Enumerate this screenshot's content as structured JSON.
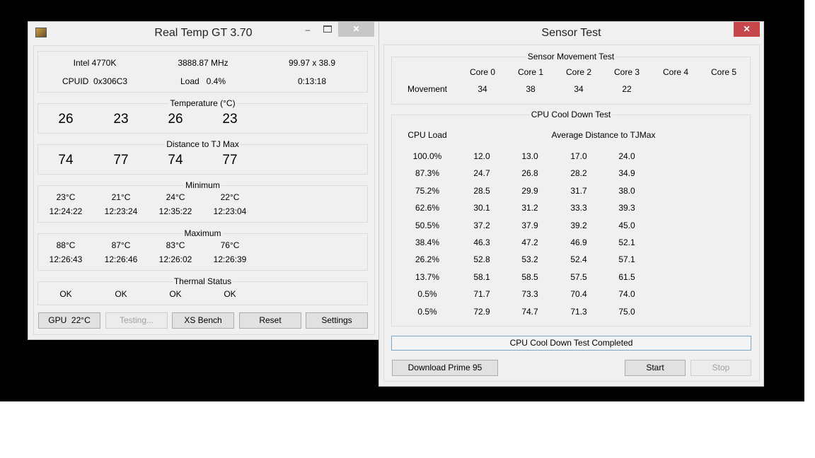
{
  "realtemp": {
    "title": "Real Temp GT 3.70",
    "cpu": "Intel 4770K",
    "mhz": "3888.87 MHz",
    "multiplier": "99.97 x 38.9",
    "cpuid": "CPUID  0x306C3",
    "load": "Load   0.4%",
    "uptime": "0:13:18",
    "temperature": {
      "label": "Temperature (°C)",
      "values": [
        "26",
        "23",
        "26",
        "23"
      ]
    },
    "distance": {
      "label": "Distance to TJ Max",
      "values": [
        "74",
        "77",
        "74",
        "77"
      ]
    },
    "minimum": {
      "label": "Minimum",
      "temps": [
        "23°C",
        "21°C",
        "24°C",
        "22°C"
      ],
      "times": [
        "12:24:22",
        "12:23:24",
        "12:35:22",
        "12:23:04"
      ]
    },
    "maximum": {
      "label": "Maximum",
      "temps": [
        "88°C",
        "87°C",
        "83°C",
        "76°C"
      ],
      "times": [
        "12:26:43",
        "12:26:46",
        "12:26:02",
        "12:26:39"
      ]
    },
    "thermal": {
      "label": "Thermal Status",
      "values": [
        "OK",
        "OK",
        "OK",
        "OK"
      ]
    },
    "buttons": {
      "gpu": "GPU  22°C",
      "testing": "Testing...",
      "xs_bench": "XS Bench",
      "reset": "Reset",
      "settings": "Settings"
    }
  },
  "sensortest": {
    "title": "Sensor Test",
    "movement": {
      "label": "Sensor Movement Test",
      "row_label": "Movement",
      "cores": [
        "Core 0",
        "Core 1",
        "Core 2",
        "Core 3",
        "Core 4",
        "Core 5"
      ],
      "values": [
        "34",
        "38",
        "34",
        "22"
      ]
    },
    "cooldown": {
      "label": "CPU Cool Down Test",
      "load_header": "CPU Load",
      "avg_header": "Average Distance to TJMax",
      "rows": [
        {
          "load": "100.0%",
          "values": [
            "12.0",
            "13.0",
            "17.0",
            "24.0"
          ]
        },
        {
          "load": "87.3%",
          "values": [
            "24.7",
            "26.8",
            "28.2",
            "34.9"
          ]
        },
        {
          "load": "75.2%",
          "values": [
            "28.5",
            "29.9",
            "31.7",
            "38.0"
          ]
        },
        {
          "load": "62.6%",
          "values": [
            "30.1",
            "31.2",
            "33.3",
            "39.3"
          ]
        },
        {
          "load": "50.5%",
          "values": [
            "37.2",
            "37.9",
            "39.2",
            "45.0"
          ]
        },
        {
          "load": "38.4%",
          "values": [
            "46.3",
            "47.2",
            "46.9",
            "52.1"
          ]
        },
        {
          "load": "26.2%",
          "values": [
            "52.8",
            "53.2",
            "52.4",
            "57.1"
          ]
        },
        {
          "load": "13.7%",
          "values": [
            "58.1",
            "58.5",
            "57.5",
            "61.5"
          ]
        },
        {
          "load": "0.5%",
          "values": [
            "71.7",
            "73.3",
            "70.4",
            "74.0"
          ]
        },
        {
          "load": "0.5%",
          "values": [
            "72.9",
            "74.7",
            "71.3",
            "75.0"
          ]
        }
      ]
    },
    "status": "CPU Cool Down Test Completed",
    "buttons": {
      "download": "Download Prime 95",
      "start": "Start",
      "stop": "Stop"
    }
  }
}
